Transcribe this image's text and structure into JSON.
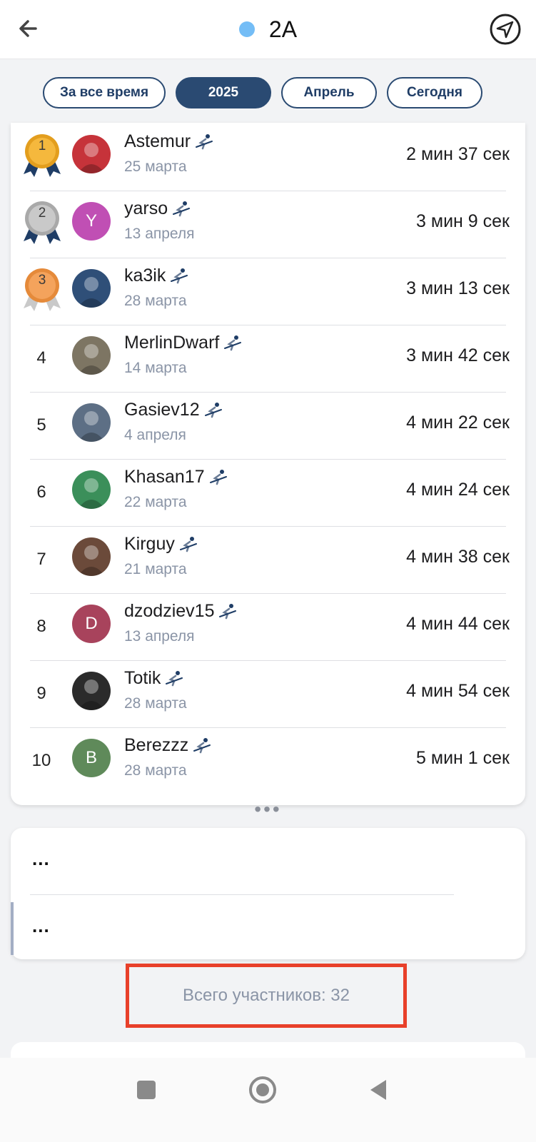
{
  "header": {
    "title": "2А",
    "dot_color": "#74bdf6"
  },
  "filters": [
    {
      "label": "За все время",
      "active": false
    },
    {
      "label": "2025",
      "active": true
    },
    {
      "label": "Апрель",
      "active": false
    },
    {
      "label": "Сегодня",
      "active": false
    }
  ],
  "leaderboard": [
    {
      "rank": "1",
      "medal": "gold",
      "name": "Astemur",
      "date": "25 марта",
      "time": "2 мин 37 сек",
      "avatar_letter": "",
      "avatar_color": "#c6333a"
    },
    {
      "rank": "2",
      "medal": "silver",
      "name": "yarso",
      "date": "13 апреля",
      "time": "3 мин 9 сек",
      "avatar_letter": "Y",
      "avatar_color": "#c04fb4"
    },
    {
      "rank": "3",
      "medal": "bronze",
      "name": "ka3ik",
      "date": "28 марта",
      "time": "3 мин 13 сек",
      "avatar_letter": "",
      "avatar_color": "#2f4f78"
    },
    {
      "rank": "4",
      "medal": "",
      "name": "MerlinDwarf",
      "date": "14 марта",
      "time": "3 мин 42 сек",
      "avatar_letter": "",
      "avatar_color": "#7d7563"
    },
    {
      "rank": "5",
      "medal": "",
      "name": "Gasiev12",
      "date": "4 апреля",
      "time": "4 мин 22 сек",
      "avatar_letter": "",
      "avatar_color": "#5d6f85"
    },
    {
      "rank": "6",
      "medal": "",
      "name": "Khasan17",
      "date": "22 марта",
      "time": "4 мин 24 сек",
      "avatar_letter": "",
      "avatar_color": "#3b8f5a"
    },
    {
      "rank": "7",
      "medal": "",
      "name": "Kirguy",
      "date": "21 марта",
      "time": "4 мин 38 сек",
      "avatar_letter": "",
      "avatar_color": "#6b4a3a"
    },
    {
      "rank": "8",
      "medal": "",
      "name": "dzodziev15",
      "date": "13 апреля",
      "time": "4 мин 44 сек",
      "avatar_letter": "D",
      "avatar_color": "#a8435c"
    },
    {
      "rank": "9",
      "medal": "",
      "name": "Totik",
      "date": "28 марта",
      "time": "4 мин 54 сек",
      "avatar_letter": "",
      "avatar_color": "#2b2b2b"
    },
    {
      "rank": "10",
      "medal": "",
      "name": "Berezzz",
      "date": "28 марта",
      "time": "5 мин 1 сек",
      "avatar_letter": "B",
      "avatar_color": "#5f8a5a"
    }
  ],
  "more_indicator": "•••",
  "others": [
    {
      "rank": "...",
      "name": ""
    },
    {
      "rank": "...",
      "name": ""
    }
  ],
  "total": "Всего участников: 32",
  "colors": {
    "accent": "#2a4a72",
    "highlight_border": "#e8402a"
  }
}
